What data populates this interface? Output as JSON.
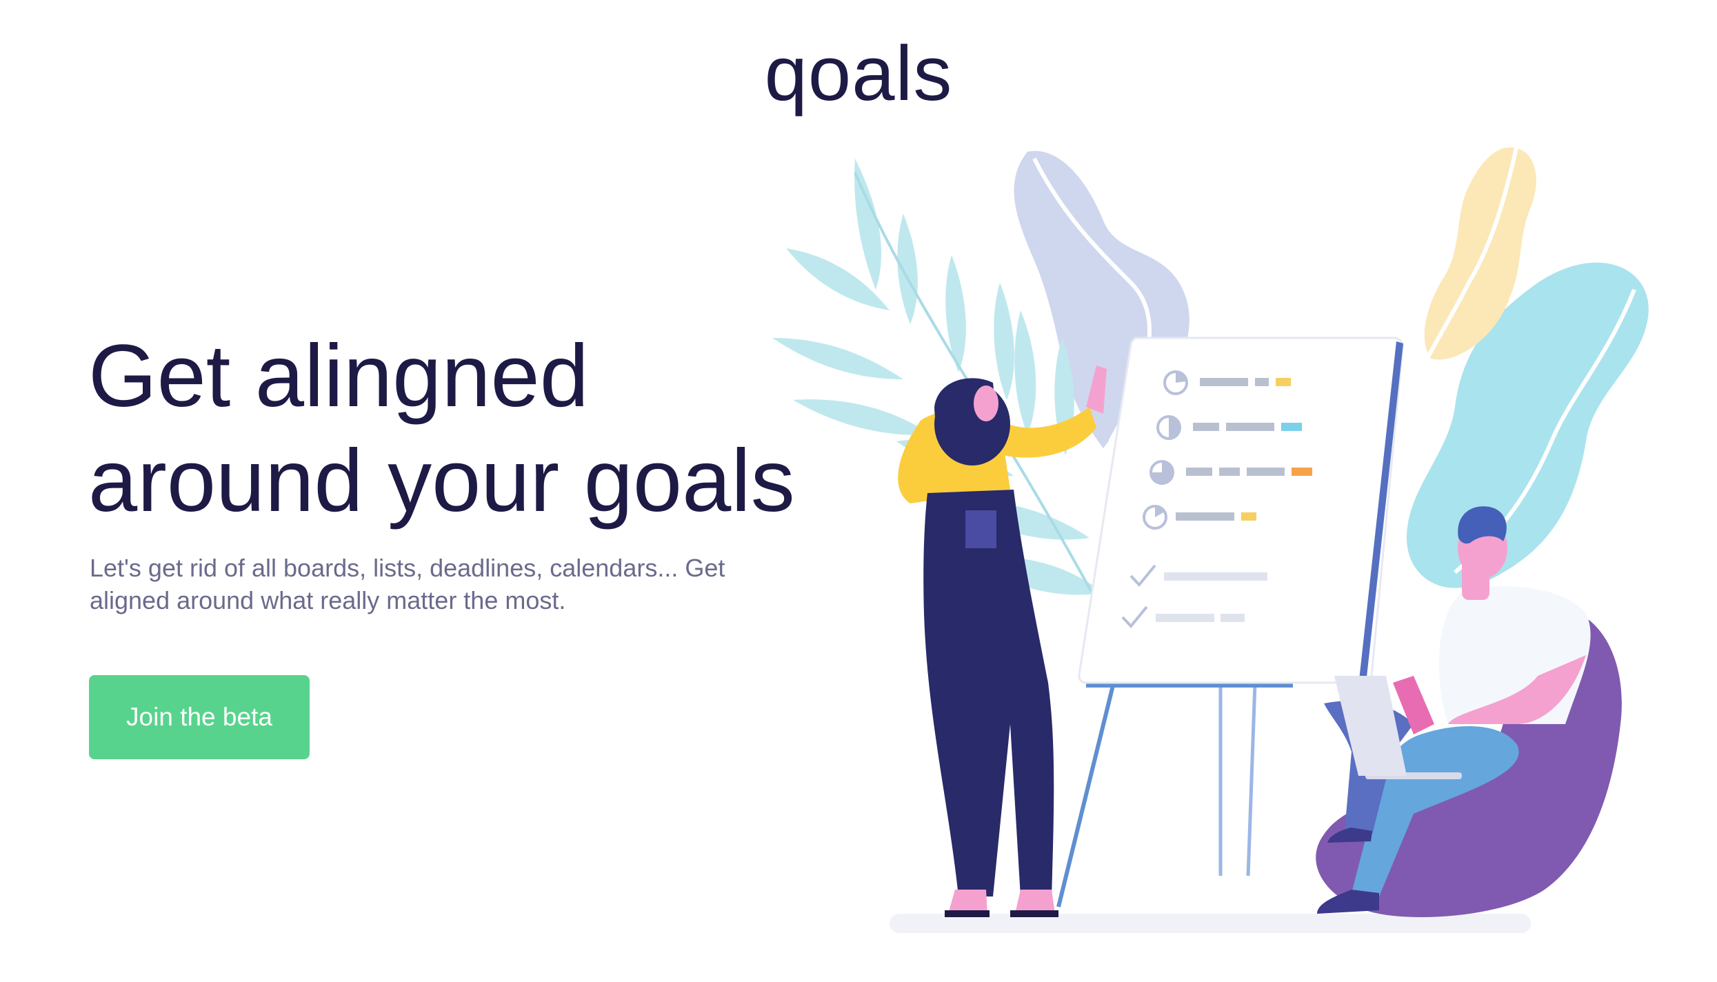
{
  "brand": {
    "logo_text": "qoals"
  },
  "hero": {
    "title_line1": "Get alingned",
    "title_line2": "around your goals",
    "subtitle": "Let's get rid of all boards, lists, deadlines, calendars... Get aligned around what really matter the most.",
    "cta_label": "Join the beta"
  },
  "colors": {
    "heading": "#1d1a45",
    "subtitle": "#6a6a8c",
    "cta_background": "#58d38d",
    "cta_text": "#ffffff",
    "leaf_teal": "#a9e3ee",
    "leaf_lavender": "#cfd7ee",
    "leaf_yellow": "#fbe8b6",
    "woman_top": "#fbcd3d",
    "woman_pants": "#282a69",
    "man_shirt": "#f4f8fc",
    "man_pants": "#65a6dc",
    "beanbag": "#805ab0",
    "board_frame": "#5570c0"
  },
  "illustration": {
    "subject": "woman presenting a checklist on a flip board to a man sitting on a beanbag with a laptop",
    "icons": [
      "pie-chart-icon",
      "check-icon"
    ]
  }
}
